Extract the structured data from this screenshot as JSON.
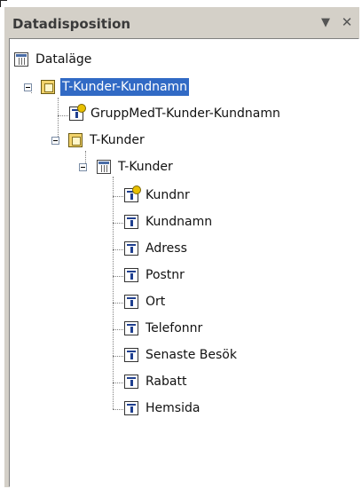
{
  "panel": {
    "title": "Datadisposition",
    "menu_glyph": "▼",
    "close_glyph": "✕"
  },
  "tree": {
    "root": {
      "label": "Dataläge",
      "icon": "database-icon"
    },
    "query": {
      "label": "T-Kunder-Kundnamn",
      "icon": "query-icon",
      "selected": true
    },
    "group": {
      "label": "GruppMedT-Kunder-Kundnamn",
      "icon": "group-field-icon"
    },
    "table_parent": {
      "label": "T-Kunder",
      "icon": "query-icon"
    },
    "table": {
      "label": "T-Kunder",
      "icon": "table-icon"
    },
    "fields": [
      {
        "label": "Kundnr",
        "key": true
      },
      {
        "label": "Kundnamn",
        "key": false
      },
      {
        "label": "Adress",
        "key": false
      },
      {
        "label": "Postnr",
        "key": false
      },
      {
        "label": "Ort",
        "key": false
      },
      {
        "label": "Telefonnr",
        "key": false
      },
      {
        "label": "Senaste Besök",
        "key": false
      },
      {
        "label": "Rabatt",
        "key": false
      },
      {
        "label": "Hemsida",
        "key": false
      }
    ]
  },
  "colors": {
    "selection": "#316ac5",
    "panel": "#d4d0c8"
  }
}
